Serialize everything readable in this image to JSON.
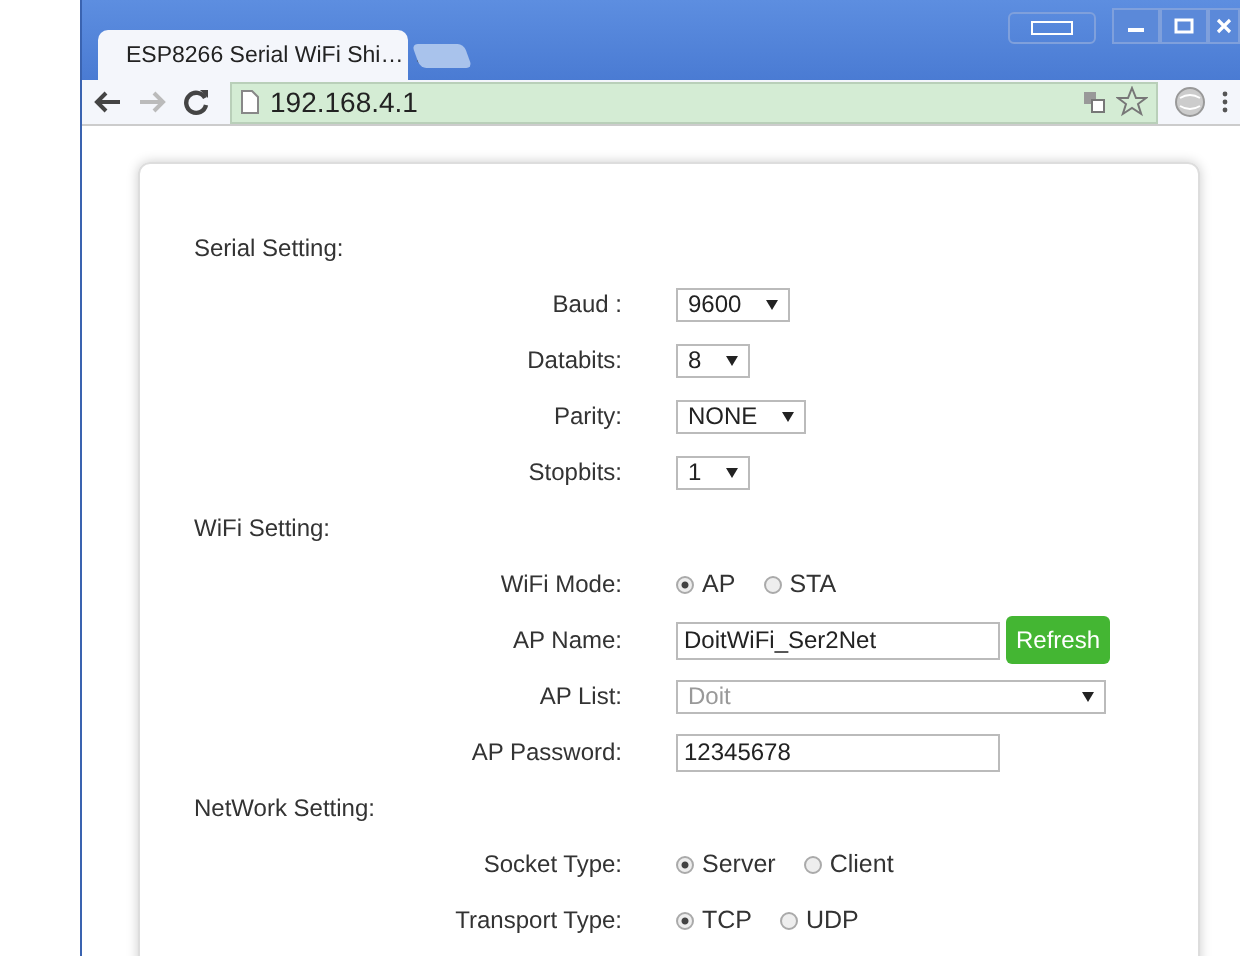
{
  "window": {
    "tab_title": "ESP8266 Serial WiFi Shi…",
    "address": "192.168.4.1"
  },
  "sections": [
    {
      "title": "Serial Setting:",
      "rows": [
        {
          "kind": "select",
          "label": "Baud :",
          "value": "9600"
        },
        {
          "kind": "select",
          "label": "Databits:",
          "value": "8"
        },
        {
          "kind": "select",
          "label": "Parity:",
          "value": "NONE"
        },
        {
          "kind": "select",
          "label": "Stopbits:",
          "value": "1"
        }
      ]
    },
    {
      "title": "WiFi Setting:",
      "rows": [
        {
          "kind": "radio",
          "label": "WiFi Mode:",
          "options": [
            {
              "label": "AP",
              "selected": true
            },
            {
              "label": "STA",
              "selected": false
            }
          ]
        },
        {
          "kind": "input",
          "label": "AP Name:",
          "value": "DoitWiFi_Ser2Net",
          "button": "Refresh"
        },
        {
          "kind": "wide-select",
          "label": "AP List:",
          "value": "Doit",
          "disabled": true
        },
        {
          "kind": "input",
          "label": "AP Password:",
          "value": "12345678"
        }
      ]
    },
    {
      "title": "NetWork Setting:",
      "rows": [
        {
          "kind": "radio",
          "label": "Socket Type:",
          "options": [
            {
              "label": "Server",
              "selected": true
            },
            {
              "label": "Client",
              "selected": false
            }
          ]
        },
        {
          "kind": "radio",
          "label": "Transport Type:",
          "options": [
            {
              "label": "TCP",
              "selected": true
            },
            {
              "label": "UDP",
              "selected": false
            }
          ]
        }
      ]
    }
  ]
}
